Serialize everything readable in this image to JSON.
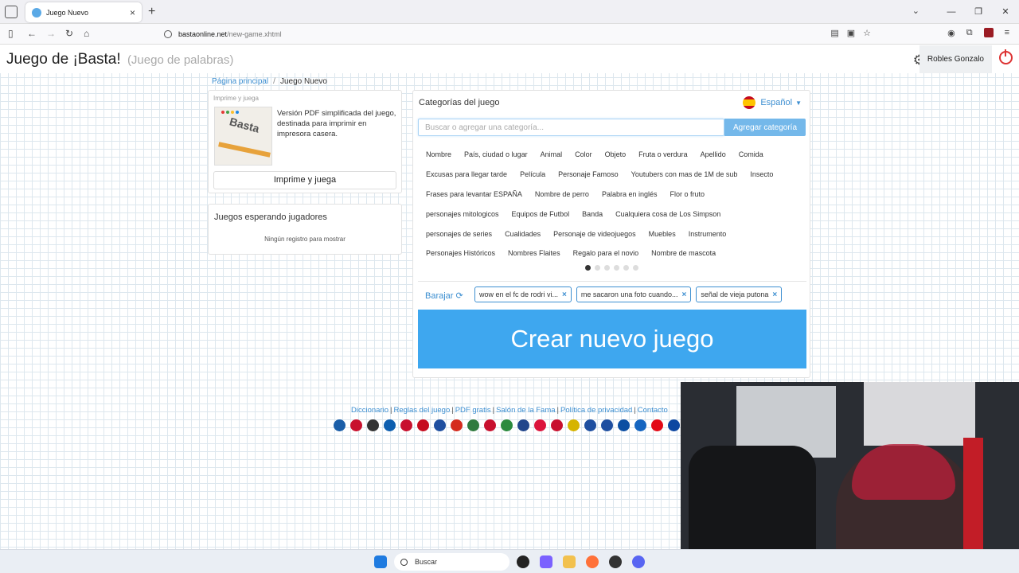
{
  "browser": {
    "tab_title": "Juego Nuevo",
    "url_domain": "bastaonline.net",
    "url_path": "/new-game.xhtml"
  },
  "header": {
    "title": "Juego de ¡Basta!",
    "subtitle": "(Juego de palabras)",
    "user_name": "Robles Gonzalo"
  },
  "breadcrumb": {
    "home": "Página principal",
    "separator": "/",
    "current": "Juego Nuevo"
  },
  "print_card": {
    "label": "Imprime y juega",
    "description": "Versión PDF simplificada del juego, destinada para imprimir en impresora casera.",
    "button": "Imprime y juega",
    "thumb_text": "Basta"
  },
  "waiting": {
    "title": "Juegos esperando jugadores",
    "empty": "Ningún registro para mostrar"
  },
  "categories": {
    "title": "Categorías del juego",
    "language": "Español",
    "search_placeholder": "Buscar o agregar una categoría...",
    "add_button": "Agregar categoría",
    "rows": [
      [
        "Nombre",
        "País, ciudad o lugar",
        "Animal",
        "Color",
        "Objeto",
        "Fruta o verdura",
        "Apellido",
        "Comida"
      ],
      [
        "Excusas para llegar tarde",
        "Película",
        "Personaje Famoso",
        "Youtubers con mas de 1M de sub",
        "Insecto"
      ],
      [
        "Frases para levantar ESPAÑA",
        "Nombre de perro",
        "Palabra en inglés",
        "Flor o fruto"
      ],
      [
        "personajes mitologicos",
        "Equipos de Futbol",
        "Banda",
        "Cualquiera cosa de Los Simpson"
      ],
      [
        "personajes de series",
        "Cualidades",
        "Personaje de videojuegos",
        "Muebles",
        "Instrumento"
      ],
      [
        "Personajes Históricos",
        "Nombres Flaites",
        "Regalo para el novio",
        "Nombre de mascota"
      ]
    ],
    "page_count": 6,
    "active_page": 1,
    "shuffle_label": "Barajar",
    "selected": [
      "wow en el fc de rodri vi...",
      "me sacaron una foto cuando...",
      "señal de vieja putona"
    ],
    "create_button": "Crear nuevo juego"
  },
  "footer": {
    "links": [
      "Diccionario",
      "Reglas del juego",
      "PDF gratis",
      "Salón de la Fama",
      "Política de privacidad",
      "Contacto"
    ],
    "flag_colors": [
      "#1b5ea8",
      "#c8102e",
      "#333333",
      "#0d5eaf",
      "#c8102e",
      "#c60b1e",
      "#1f4fa0",
      "#d52b1e",
      "#2f7a3e",
      "#c8102e",
      "#2b8a3e",
      "#21468b",
      "#dc143c",
      "#c8102e",
      "#d6b400",
      "#1f4fa0",
      "#1f4fa0",
      "#0b4ea2",
      "#1565c0",
      "#e30a17",
      "#0d47a1"
    ]
  },
  "taskbar": {
    "search_placeholder": "Buscar"
  }
}
